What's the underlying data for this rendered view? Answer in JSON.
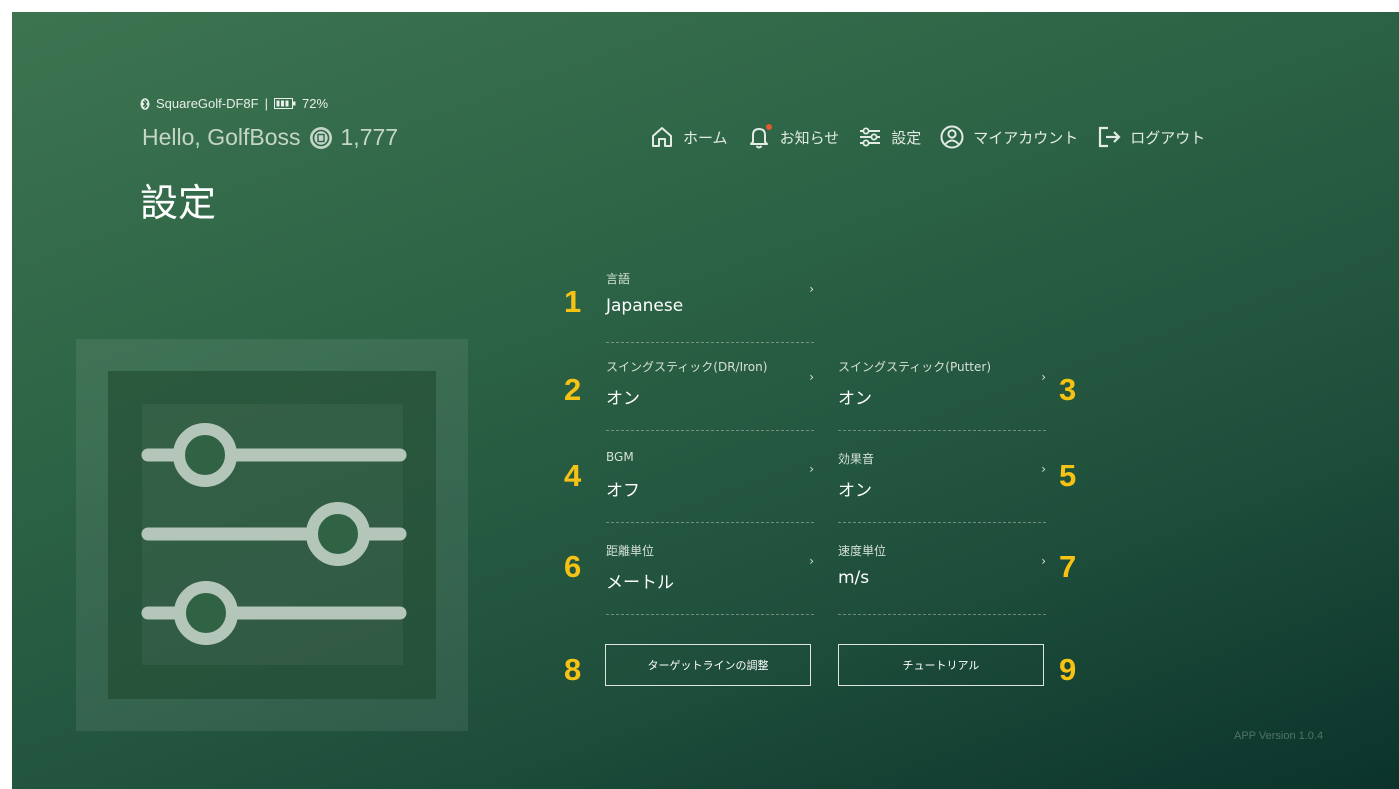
{
  "status": {
    "device": "SquareGolf-DF8F",
    "separator": "|",
    "battery": "72%"
  },
  "greeting": {
    "text": "Hello, GolfBoss",
    "coins": "1,777"
  },
  "page_title": "設定",
  "nav": {
    "home": "ホーム",
    "notices": "お知らせ",
    "settings": "設定",
    "account": "マイアカウント",
    "logout": "ログアウト"
  },
  "settings": {
    "language": {
      "num": "1",
      "label": "言語",
      "value": "Japanese"
    },
    "swing_stick_dr": {
      "num": "2",
      "label": "スイングスティック(DR/Iron)",
      "value": "オン"
    },
    "swing_stick_putter": {
      "num": "3",
      "label": "スイングスティック(Putter)",
      "value": "オン"
    },
    "bgm": {
      "num": "4",
      "label": "BGM",
      "value": "オフ"
    },
    "sound_effects": {
      "num": "5",
      "label": "効果音",
      "value": "オン"
    },
    "distance_unit": {
      "num": "6",
      "label": "距離単位",
      "value": "メートル"
    },
    "speed_unit": {
      "num": "7",
      "label": "速度単位",
      "value": "m/s"
    },
    "chevron": "›"
  },
  "buttons": {
    "target_line": {
      "num": "8",
      "label": "ターゲットラインの調整"
    },
    "tutorial": {
      "num": "9",
      "label": "チュートリアル"
    }
  },
  "version": "APP Version 1.0.4",
  "colors": {
    "accent_number": "#f6c315",
    "background_start": "#3d7450",
    "background_end": "#0b332b",
    "notification_dot": "#e35a2b"
  },
  "icons": [
    "bluetooth-icon",
    "battery-icon",
    "coin-icon",
    "home-icon",
    "bell-icon",
    "sliders-icon",
    "account-icon",
    "logout-icon"
  ]
}
